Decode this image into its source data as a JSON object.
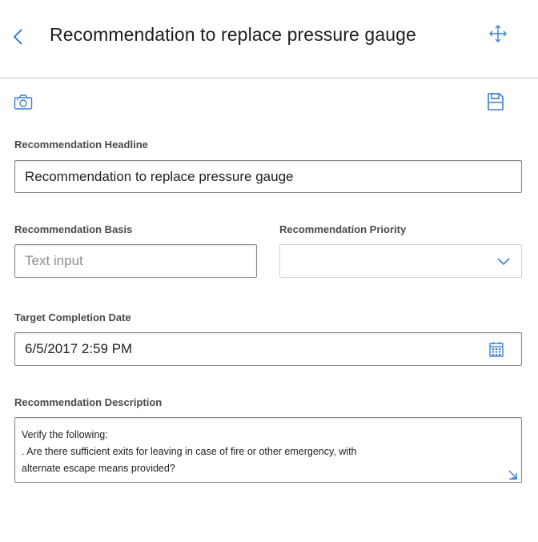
{
  "header": {
    "title": "Recommendation to replace pressure gauge",
    "back_icon": "chevron-left-icon",
    "move_icon": "move-arrows-icon"
  },
  "toolbar": {
    "camera_icon": "camera-icon",
    "save_icon": "save-icon"
  },
  "form": {
    "headline": {
      "label": "Recommendation Headline",
      "value": "Recommendation to replace pressure gauge"
    },
    "basis": {
      "label": "Recommendation Basis",
      "placeholder": "Text input"
    },
    "priority": {
      "label": "Recommendation Priority",
      "value": ""
    },
    "target_date": {
      "label": "Target Completion Date",
      "value": "6/5/2017 2:59 PM"
    },
    "description": {
      "label": "Recommendation Description",
      "lines": [
        "Verify the following:",
        ". Are there sufficient exits for leaving in case of fire or other emergency, with",
        "alternate escape means provided?"
      ]
    }
  },
  "colors": {
    "accent": "#3b7fd1",
    "border": "#8a8a8a",
    "label": "#4a4a4a"
  }
}
